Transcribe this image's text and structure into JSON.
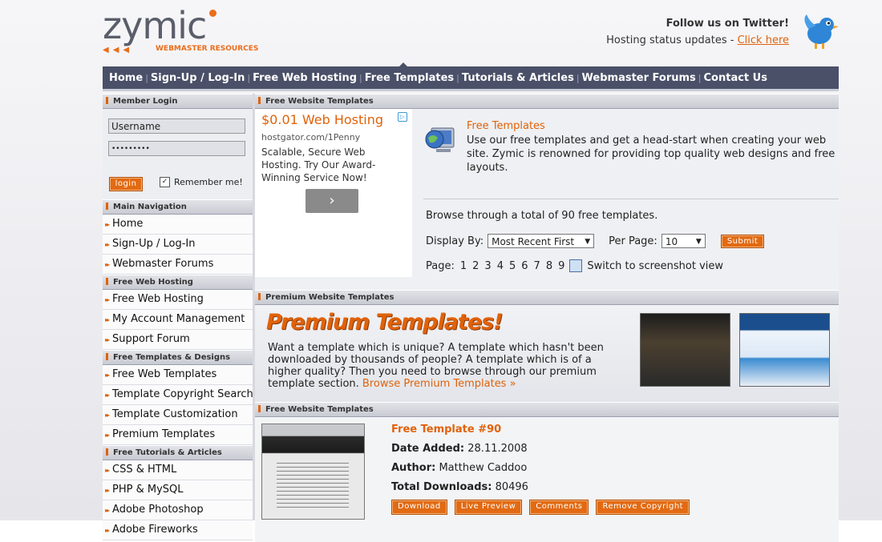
{
  "logo": {
    "word": "zymic",
    "tagline": "WEBMASTER RESOURCES",
    "arrows": "◀◀◀"
  },
  "twitter": {
    "follow": "Follow us on Twitter!",
    "status_prefix": "Hosting status updates - ",
    "link": "Click here"
  },
  "nav": [
    "Home",
    "Sign-Up / Log-In",
    "Free Web Hosting",
    "Free Templates",
    "Tutorials & Articles",
    "Webmaster Forums",
    "Contact Us"
  ],
  "nav_sep": "|",
  "login": {
    "title": "Member Login",
    "username": "Username",
    "password": "•••••••••",
    "button": "login",
    "remember": "Remember me!",
    "remember_checked": "✓"
  },
  "sidebar": {
    "main_nav_title": "Main Navigation",
    "main_nav": [
      "Home",
      "Sign-Up / Log-In",
      "Webmaster Forums"
    ],
    "hosting_title": "Free Web Hosting",
    "hosting": [
      "Free Web Hosting",
      "My Account Management",
      "Support Forum"
    ],
    "templates_title": "Free Templates & Designs",
    "templates": [
      "Free Web Templates",
      "Template Copyright Search",
      "Template Customization",
      "Premium Templates"
    ],
    "tutorials_title": "Free Tutorials & Articles",
    "tutorials": [
      "CSS & HTML",
      "PHP & MySQL",
      "Adobe Photoshop",
      "Adobe Fireworks"
    ]
  },
  "bullet": "▸▸",
  "free_section": {
    "title": "Free Website Templates",
    "ad": {
      "headline": "$0.01 Web Hosting",
      "url": "hostgator.com/1Penny",
      "text": "Scalable, Secure Web Hosting. Try Our Award-Winning Service Now!",
      "go": "›",
      "adchoice": "▷"
    },
    "intro_title": "Free Templates",
    "intro_text": "Use our free templates and get a head-start when creating your web site. Zymic is renowned for providing top quality web designs and free layouts.",
    "browse": "Browse through a total of 90 free templates.",
    "display_by_label": "Display By:",
    "display_by_value": "Most Recent First",
    "per_page_label": "Per Page:",
    "per_page_value": "10",
    "submit": "Submit",
    "page_label": "Page:",
    "pages": [
      "1",
      "2",
      "3",
      "4",
      "5",
      "6",
      "7",
      "8",
      "9"
    ],
    "switch": "Switch to screenshot view"
  },
  "premium": {
    "title": "Premium Website Templates",
    "banner": "Premium Templates!",
    "text": "Want a template which is unique? A template which hasn't been downloaded by thousands of people? A template which is of a higher quality? Then you need to browse through our premium template section.",
    "link": "Browse Premium Templates »"
  },
  "listing": {
    "title": "Free Website Templates",
    "item": {
      "name": "Free Template #90",
      "date_label": "Date Added:",
      "date": "28.11.2008",
      "author_label": "Author:",
      "author": "Matthew Caddoo",
      "downloads_label": "Total Downloads:",
      "downloads": "80496",
      "buttons": [
        "Download",
        "Live Preview",
        "Comments",
        "Remove Copyright"
      ]
    }
  },
  "dropdown_arrow": "▼",
  "colors": {
    "accent": "#e0620a",
    "nav": "#4a5068"
  }
}
